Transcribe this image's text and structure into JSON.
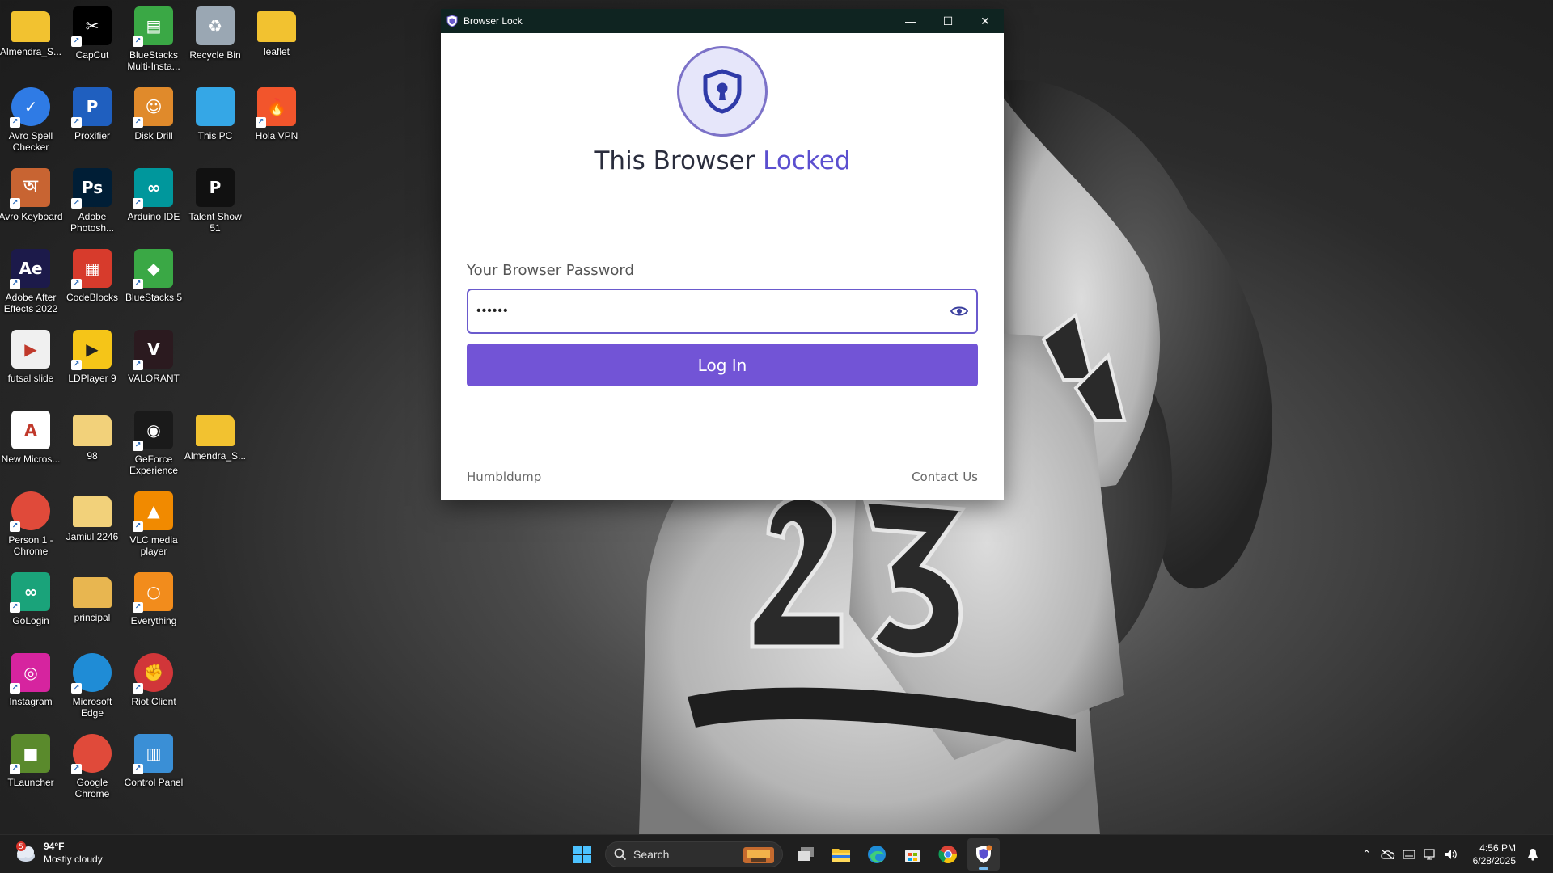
{
  "desktop": {
    "icons": [
      {
        "label": "Almendra_S...",
        "icon": "folder-icon",
        "color": "#f2c230"
      },
      {
        "label": "CapCut",
        "icon": "capcut-icon",
        "color": "#000000"
      },
      {
        "label": "BlueStacks Multi-Insta...",
        "icon": "bluestacks-multi-icon",
        "color": "#3aa845"
      },
      {
        "label": "Recycle Bin",
        "icon": "recycle-bin-icon",
        "color": "#9aa7b3"
      },
      {
        "label": "leaflet",
        "icon": "folder-icon",
        "color": "#f2c230"
      },
      {
        "label": "Avro Spell Checker",
        "icon": "avro-spell-icon",
        "color": "#2f7be5"
      },
      {
        "label": "Proxifier",
        "icon": "proxifier-icon",
        "color": "#1f5fbf"
      },
      {
        "label": "Disk Drill",
        "icon": "disk-drill-icon",
        "color": "#e08a2b"
      },
      {
        "label": "This PC",
        "icon": "this-pc-icon",
        "color": "#35a7e6"
      },
      {
        "label": "Hola VPN",
        "icon": "hola-vpn-icon",
        "color": "#f2552c"
      },
      {
        "label": "Avro Keyboard",
        "icon": "avro-keyboard-icon",
        "color": "#c86432"
      },
      {
        "label": "Adobe Photosh...",
        "icon": "photoshop-icon",
        "color": "#001e36"
      },
      {
        "label": "Arduino IDE",
        "icon": "arduino-icon",
        "color": "#00979c"
      },
      {
        "label": "Talent Show 51",
        "icon": "powerpoint-file-icon",
        "color": "#111111"
      },
      {
        "label": "Adobe After Effects 2022",
        "icon": "after-effects-icon",
        "color": "#1c1a4a"
      },
      {
        "label": "CodeBlocks",
        "icon": "codeblocks-icon",
        "color": "#d73b2c"
      },
      {
        "label": "BlueStacks 5",
        "icon": "bluestacks-icon",
        "color": "#3aa845"
      },
      {
        "label": "futsal slide",
        "icon": "video-file-icon",
        "color": "#f0f0f0"
      },
      {
        "label": "LDPlayer 9",
        "icon": "ldplayer-icon",
        "color": "#f5c518"
      },
      {
        "label": "VALORANT",
        "icon": "valorant-icon",
        "color": "#2b1a1f"
      },
      {
        "label": "New Micros...",
        "icon": "access-file-icon",
        "color": "#ffffff"
      },
      {
        "label": "98",
        "icon": "folder-icon",
        "color": "#f2d17a"
      },
      {
        "label": "GeForce Experience",
        "icon": "geforce-icon",
        "color": "#1a1a1a"
      },
      {
        "label": "Almendra_S...",
        "icon": "zip-folder-icon",
        "color": "#f2c230"
      },
      {
        "label": "Person 1 - Chrome",
        "icon": "chrome-profile-icon",
        "color": "#e04a3a"
      },
      {
        "label": "Jamiul 2246",
        "icon": "folder-icon",
        "color": "#f2d17a"
      },
      {
        "label": "VLC media player",
        "icon": "vlc-icon",
        "color": "#f18a00"
      },
      {
        "label": "GoLogin",
        "icon": "gologin-icon",
        "color": "#1aa37a"
      },
      {
        "label": "principal",
        "icon": "folder-icon",
        "color": "#e8b650"
      },
      {
        "label": "Everything",
        "icon": "everything-icon",
        "color": "#f28c1c"
      },
      {
        "label": "Instagram",
        "icon": "instagram-icon",
        "color": "#d6249f"
      },
      {
        "label": "Microsoft Edge",
        "icon": "edge-icon",
        "color": "#1f8cd6"
      },
      {
        "label": "Riot Client",
        "icon": "riot-client-icon",
        "color": "#d13639"
      },
      {
        "label": "TLauncher",
        "icon": "tlauncher-icon",
        "color": "#5a8a2c"
      },
      {
        "label": "Google Chrome",
        "icon": "chrome-icon",
        "color": "#e04a3a"
      },
      {
        "label": "Control Panel",
        "icon": "control-panel-icon",
        "color": "#3a8fd6"
      }
    ]
  },
  "window": {
    "title": "Browser Lock",
    "heading_prefix": "This Browser",
    "heading_accent": "Locked",
    "password_label": "Your Browser Password",
    "password_value": "••••••",
    "login_label": "Log In",
    "footer_left": "Humbldump",
    "footer_right": "Contact Us",
    "accent_color": "#7254d6"
  },
  "taskbar": {
    "weather_temp": "94°F",
    "weather_desc": "Mostly cloudy",
    "weather_badge": "5",
    "search_placeholder": "Search",
    "time": "4:56 PM",
    "date": "6/28/2025"
  }
}
